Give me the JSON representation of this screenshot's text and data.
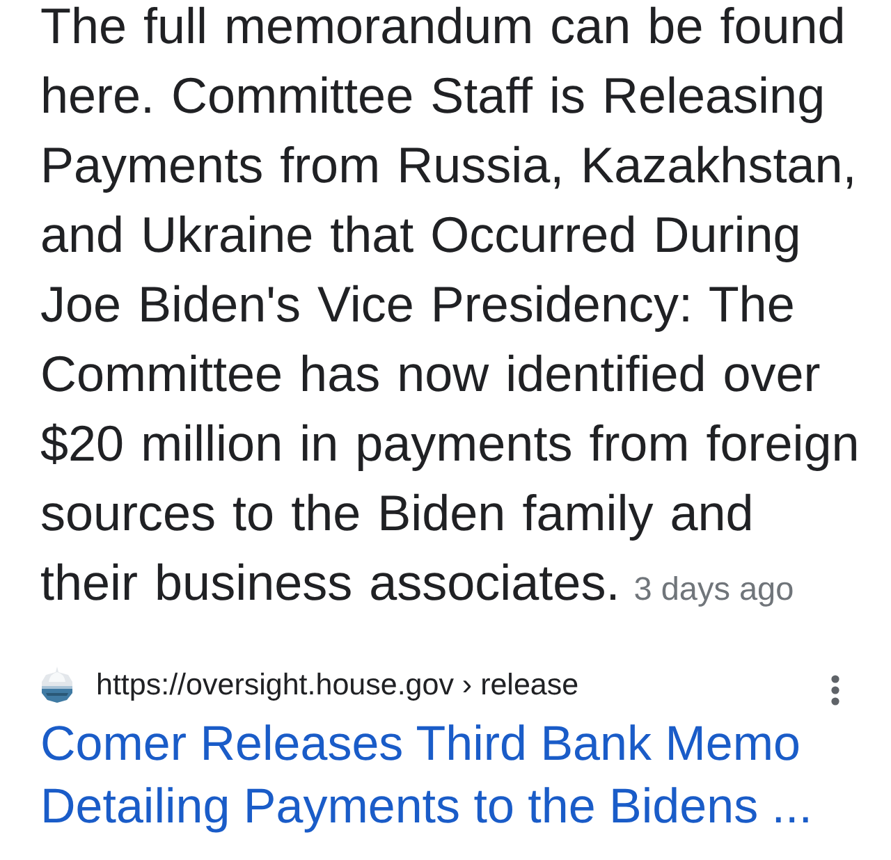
{
  "snippet": {
    "text": "The full memorandum can be found here. Committee Staff is Releasing Payments from Russia, Kazakhstan, and Ukraine that Occurred During Joe Biden's Vice Presidency: The Committee has now identified over $20 million in payments from foreign sources to the Biden family and their business associates.",
    "date": "3 days ago"
  },
  "result": {
    "url": "https://oversight.house.gov › release",
    "title": "Comer Releases Third Bank Memo Detailing Payments to the Bidens ..."
  }
}
